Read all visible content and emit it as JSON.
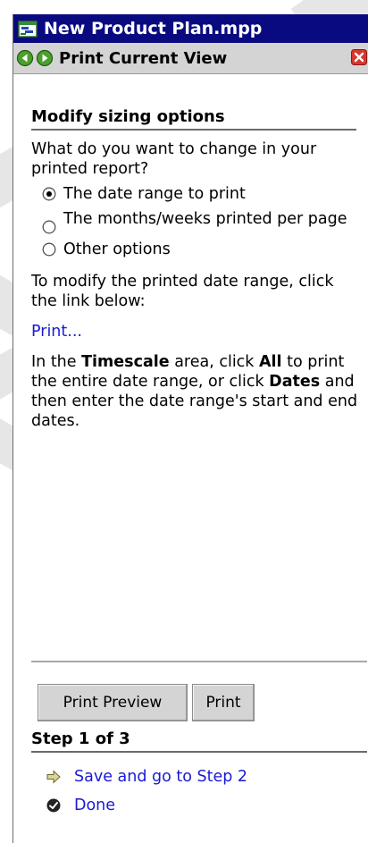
{
  "window": {
    "title": "New Product Plan.mpp"
  },
  "nav": {
    "title": "Print Current View",
    "back_icon": "back-arrow-icon",
    "forward_icon": "forward-arrow-icon",
    "close_icon": "close-icon"
  },
  "main": {
    "heading": "Modify sizing options",
    "question": "What do you want to change in your printed report?",
    "options": [
      {
        "label": "The date range to print",
        "selected": true
      },
      {
        "label": "The months/weeks printed per page",
        "selected": false
      },
      {
        "label": "Other options",
        "selected": false
      }
    ],
    "instruction": "To modify the printed date range, click the link below:",
    "print_link": "Print...",
    "timescale_text": {
      "part1": "In the ",
      "bold1": "Timescale",
      "part2": " area, click ",
      "bold2": "All",
      "part3": " to print the entire date range, or click ",
      "bold3": "Dates",
      "part4": " and then enter the date range's start and end dates."
    }
  },
  "buttons": {
    "print_preview": "Print Preview",
    "print": "Print"
  },
  "steps": {
    "heading": "Step 1 of 3",
    "next": {
      "label": "Save and go to Step 2",
      "icon": "right-arrow-icon"
    },
    "done": {
      "label": "Done",
      "icon": "check-circle-icon"
    }
  },
  "colors": {
    "title_bar": "#0a0a80",
    "nav_bar": "#d4d4d4",
    "link": "#1a1ad6",
    "close_button": "#d9362e",
    "nav_arrows": "#4ca02c"
  }
}
